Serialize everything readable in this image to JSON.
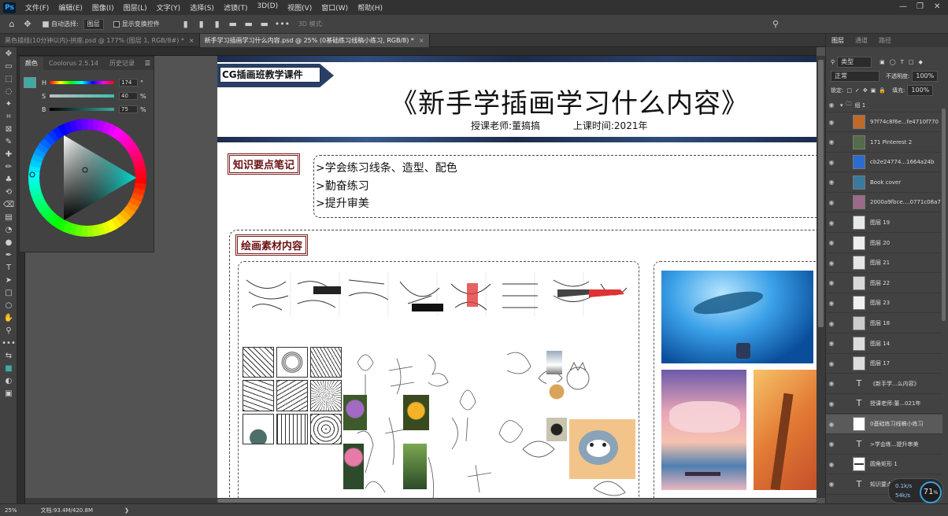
{
  "menubar": {
    "logo": "Ps",
    "items": [
      "文件(F)",
      "编辑(E)",
      "图像(I)",
      "图层(L)",
      "文字(Y)",
      "选择(S)",
      "滤镜(T)",
      "3D(D)",
      "视图(V)",
      "窗口(W)",
      "帮助(H)"
    ]
  },
  "options": {
    "auto_select_label": "自动选择:",
    "auto_select_value": "图层",
    "transform_label": "显示变换控件",
    "more": "•••",
    "threed_label": "3D 模式:"
  },
  "tabs": [
    {
      "label": "黑色描线(10分钟以内)-拱座.psd @ 177% (图层 1, RGB/8#) *",
      "active": false
    },
    {
      "label": "新手学习插画学习什么内容.psd @ 25% (0基础练习线稿小练习, RGB/8) *",
      "active": true
    }
  ],
  "color_panel": {
    "tabs": [
      "颜色",
      "Coolorus 2.5.14",
      "历史记录"
    ],
    "sliders": [
      {
        "label": "H",
        "value": "174",
        "unit": "°"
      },
      {
        "label": "S",
        "value": "40",
        "unit": "%"
      },
      {
        "label": "B",
        "value": "75",
        "unit": "%"
      }
    ],
    "swatch": "#3fa9a3"
  },
  "canvas_doc": {
    "tag": "CG插画班教学课件",
    "title": "《新手学插画学习什么内容》",
    "teacher": "授课老师:董搞搞",
    "time": "上课时间:2021年",
    "section1": "知识要点笔记",
    "points": [
      ">学会练习线条、造型、配色",
      ">勤奋练习",
      ">提升审美"
    ],
    "section2": "绘画素材内容"
  },
  "layers_panel": {
    "tabs": [
      "图层",
      "通道",
      "路径"
    ],
    "filter_label": "类型",
    "blend": "正常",
    "opacity_label": "不透明度:",
    "opacity": "100%",
    "lock_label": "锁定:",
    "fill_label": "填充:",
    "fill": "100%",
    "group": "组 1",
    "layers": [
      {
        "name": "97f74c8f6e...fe4710f770",
        "kind": "img",
        "color": "#c06a2a"
      },
      {
        "name": "171 Pinterest 2",
        "kind": "img",
        "color": "#556b4a"
      },
      {
        "name": "cb2e24774...1664a24b",
        "kind": "img",
        "color": "#2b6cd1"
      },
      {
        "name": "Book cover",
        "kind": "img",
        "color": "#3a7a9a"
      },
      {
        "name": "2000a9fbce....0771c08a7",
        "kind": "img",
        "color": "#9a6a8a"
      },
      {
        "name": "图层 19",
        "kind": "img",
        "color": "#e8e8e8"
      },
      {
        "name": "图层 20",
        "kind": "img",
        "color": "#eeeeee"
      },
      {
        "name": "图层 21",
        "kind": "img",
        "color": "#e6e6e6"
      },
      {
        "name": "图层 22",
        "kind": "img",
        "color": "#d9d9d9"
      },
      {
        "name": "图层 23",
        "kind": "img",
        "color": "#f0f0f0"
      },
      {
        "name": "图层 18",
        "kind": "img",
        "color": "#cccccc"
      },
      {
        "name": "图层 14",
        "kind": "img",
        "color": "#dddddd"
      },
      {
        "name": "图层 17",
        "kind": "img",
        "color": "#dddddd"
      },
      {
        "name": "《新手学...么内容》",
        "kind": "text"
      },
      {
        "name": "授课老师:董...021年",
        "kind": "text"
      },
      {
        "name": "0基础练习线稿小练习",
        "kind": "smart",
        "selected": true
      },
      {
        "name": ">学会练...提升审美",
        "kind": "text"
      },
      {
        "name": "圆角矩形 1",
        "kind": "shape"
      },
      {
        "name": "知识要点...",
        "kind": "text"
      }
    ]
  },
  "status": {
    "zoom": "25%",
    "doc": "文档:93.4M/420.8M"
  },
  "perf": {
    "value": "71",
    "unit": "%",
    "up": "0.1k/s",
    "down": "54k/s"
  }
}
